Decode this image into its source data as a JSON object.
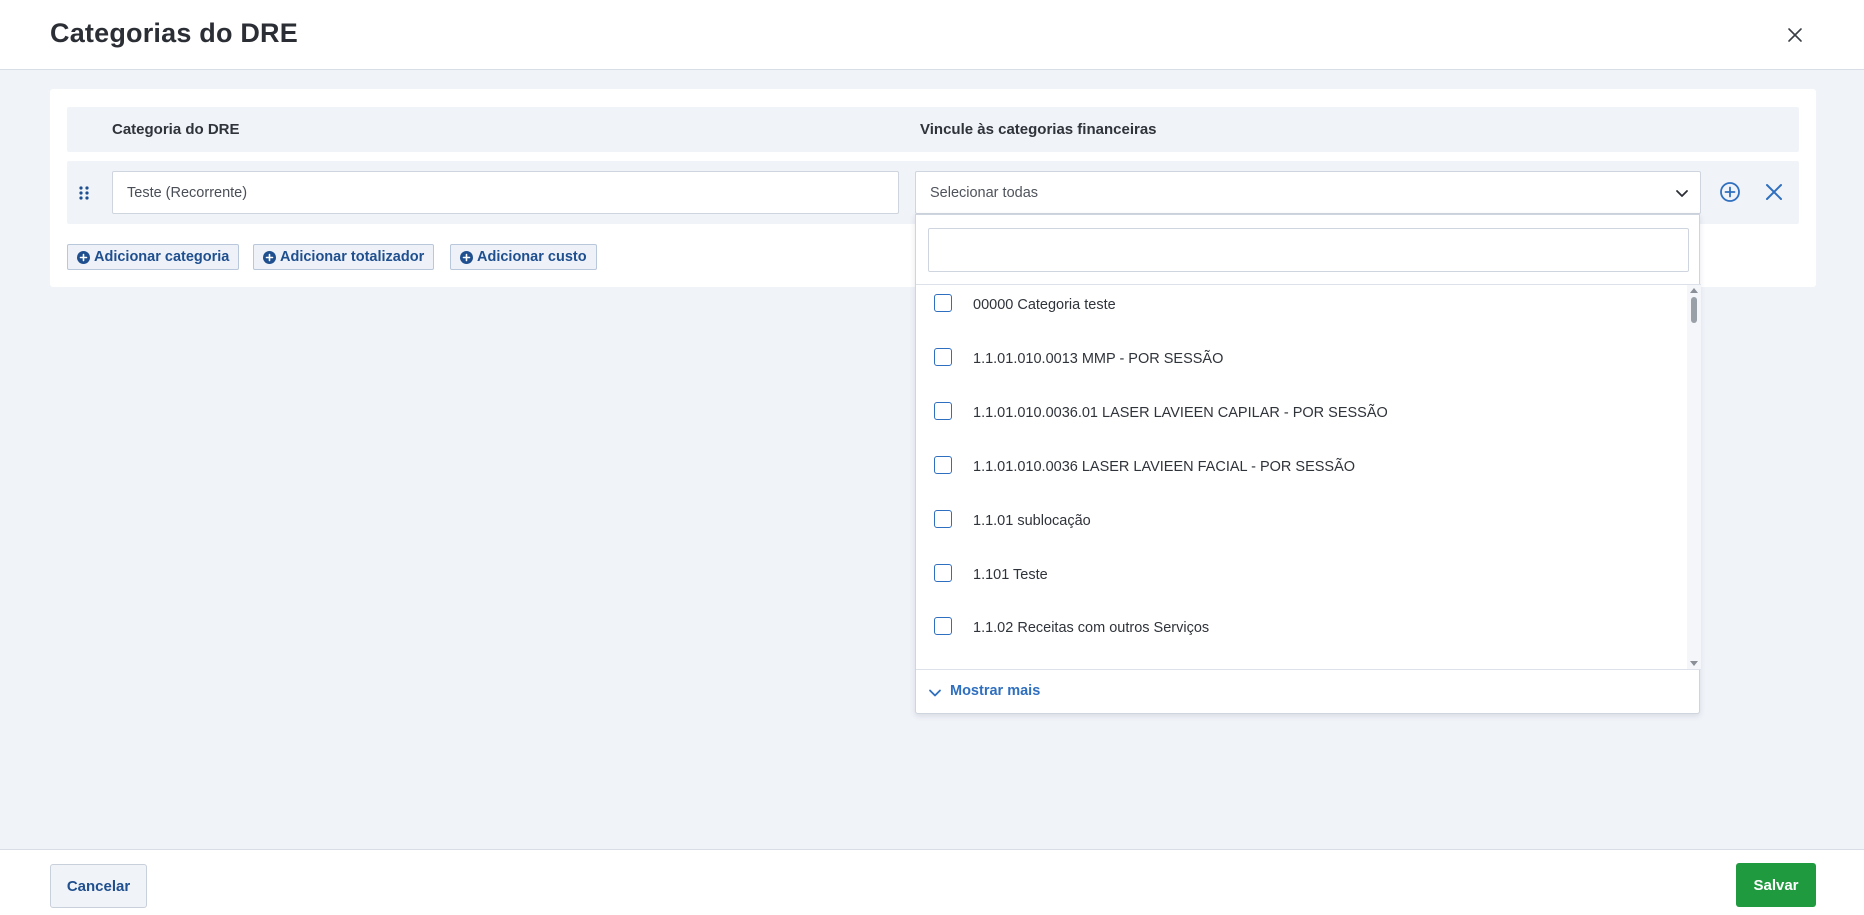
{
  "modal": {
    "title": "Categorias do DRE"
  },
  "table": {
    "col_category": "Categoria do DRE",
    "col_link": "Vincule às categorias financeiras"
  },
  "row": {
    "name_value": "Teste (Recorrente)",
    "select_value": "Selecionar todas"
  },
  "actions": {
    "add_category": "Adicionar categoria",
    "add_totalizer": "Adicionar totalizador",
    "add_cost": "Adicionar custo"
  },
  "dropdown": {
    "search_placeholder": "",
    "items": [
      "00000 Categoria teste",
      "1.1.01.010.0013 MMP - POR SESSÃO",
      "1.1.01.010.0036.01 LASER LAVIEEN CAPILAR - POR SESSÃO",
      "1.1.01.010.0036 LASER LAVIEEN FACIAL - POR SESSÃO",
      "1.1.01 sublocação",
      "1.101 Teste",
      "1.1.02 Receitas com outros Serviços"
    ],
    "show_more": "Mostrar mais"
  },
  "footer": {
    "cancel_label": "Cancelar",
    "save_label": "Salvar"
  },
  "colors": {
    "accent_blue": "#2f6fbf",
    "save_green": "#1f9a3e",
    "background": "#f0f3f8"
  },
  "icons": {
    "close": "close-icon",
    "drag": "drag-handle-icon",
    "chevron": "chevron-down-icon",
    "add": "plus-circle-icon",
    "remove": "x-icon"
  }
}
